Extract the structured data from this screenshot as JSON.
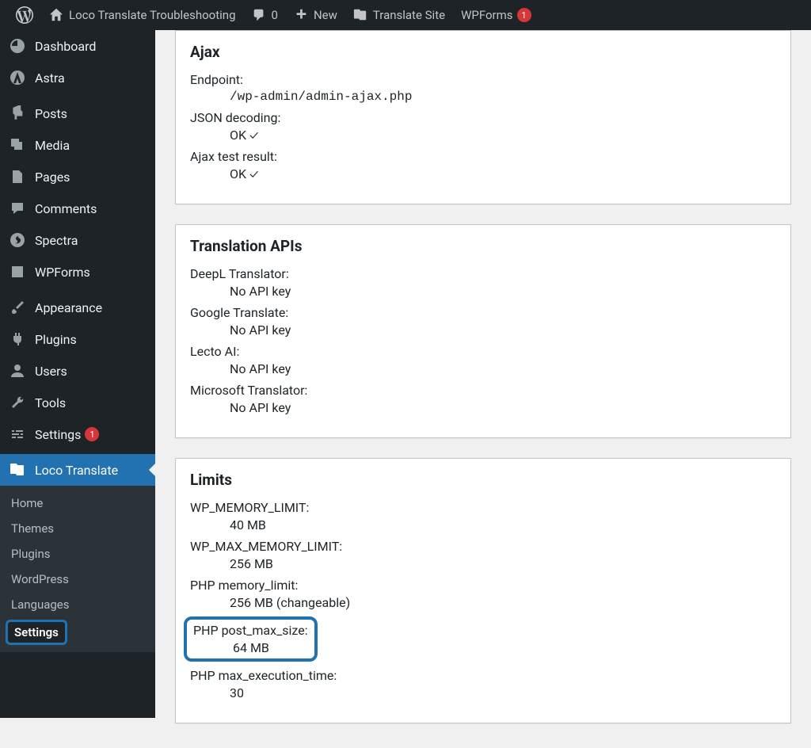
{
  "adminbar": {
    "site_name": "Loco Translate Troubleshooting",
    "comments_count": "0",
    "new_label": "New",
    "translate_site": "Translate Site",
    "wpforms": "WPForms",
    "wpforms_badge": "1"
  },
  "sidebar": {
    "items": [
      {
        "label": "Dashboard"
      },
      {
        "label": "Astra"
      },
      {
        "label": "Posts"
      },
      {
        "label": "Media"
      },
      {
        "label": "Pages"
      },
      {
        "label": "Comments"
      },
      {
        "label": "Spectra"
      },
      {
        "label": "WPForms"
      },
      {
        "label": "Appearance"
      },
      {
        "label": "Plugins"
      },
      {
        "label": "Users"
      },
      {
        "label": "Tools"
      },
      {
        "label": "Settings",
        "badge": "1"
      },
      {
        "label": "Loco Translate",
        "active": true
      }
    ],
    "submenu": [
      {
        "label": "Home"
      },
      {
        "label": "Themes"
      },
      {
        "label": "Plugins"
      },
      {
        "label": "WordPress"
      },
      {
        "label": "Languages"
      },
      {
        "label": "Settings",
        "highlight": true
      }
    ]
  },
  "panels": {
    "ajax": {
      "title": "Ajax",
      "endpoint": {
        "label": "Endpoint:",
        "value": "/wp-admin/admin-ajax.php"
      },
      "json": {
        "label": "JSON decoding:",
        "value": "OK"
      },
      "test": {
        "label": "Ajax test result:",
        "value": "OK"
      }
    },
    "apis": {
      "title": "Translation APIs",
      "deepl": {
        "label": "DeepL Translator:",
        "value": "No API key"
      },
      "google": {
        "label": "Google Translate:",
        "value": "No API key"
      },
      "lecto": {
        "label": "Lecto AI:",
        "value": "No API key"
      },
      "microsoft": {
        "label": "Microsoft Translator:",
        "value": "No API key"
      }
    },
    "limits": {
      "title": "Limits",
      "wpmem": {
        "label": "WP_MEMORY_LIMIT:",
        "value": "40 MB"
      },
      "wpmax": {
        "label": "WP_MAX_MEMORY_LIMIT:",
        "value": "256 MB"
      },
      "phpmem": {
        "label": "PHP memory_limit:",
        "value": "256 MB (changeable)"
      },
      "postmax": {
        "label": "PHP post_max_size:",
        "value": "64 MB"
      },
      "exectime": {
        "label": "PHP max_execution_time:",
        "value": "30"
      }
    }
  }
}
